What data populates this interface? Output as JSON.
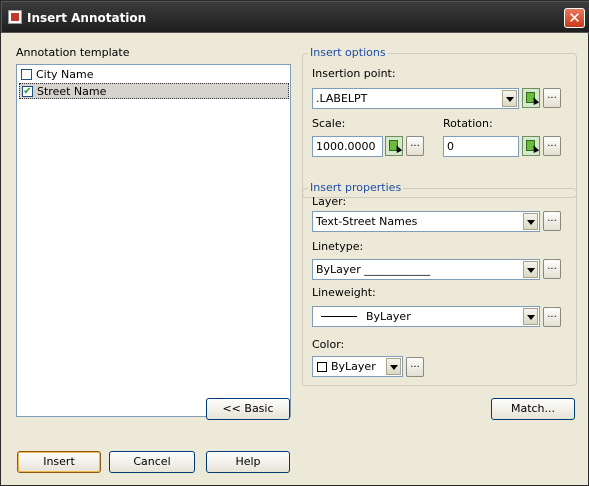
{
  "window": {
    "title": "Insert Annotation",
    "accent_color": "#1f4ea6"
  },
  "template_panel": {
    "label": "Annotation template",
    "items": [
      {
        "label": "City Name",
        "checked": false
      },
      {
        "label": "Street Name",
        "checked": true
      }
    ]
  },
  "insert_options": {
    "title": "Insert options",
    "insertion_point_label": "Insertion point:",
    "insertion_point_value": ".LABELPT",
    "scale_label": "Scale:",
    "scale_value": "1000.0000",
    "rotation_label": "Rotation:",
    "rotation_value": "0"
  },
  "insert_properties": {
    "title": "Insert properties",
    "layer_label": "Layer:",
    "layer_value": "Text-Street Names",
    "linetype_label": "Linetype:",
    "linetype_value": "ByLayer ____________",
    "lineweight_label": "Lineweight:",
    "lineweight_value": "ByLayer",
    "color_label": "Color:",
    "color_value": "ByLayer"
  },
  "buttons": {
    "basic": "<< Basic",
    "match": "Match...",
    "insert": "Insert",
    "cancel": "Cancel",
    "help": "Help",
    "browse": "..."
  },
  "icons": {
    "close": "close-icon",
    "app": "app-icon",
    "pick": "pick-point-icon"
  }
}
